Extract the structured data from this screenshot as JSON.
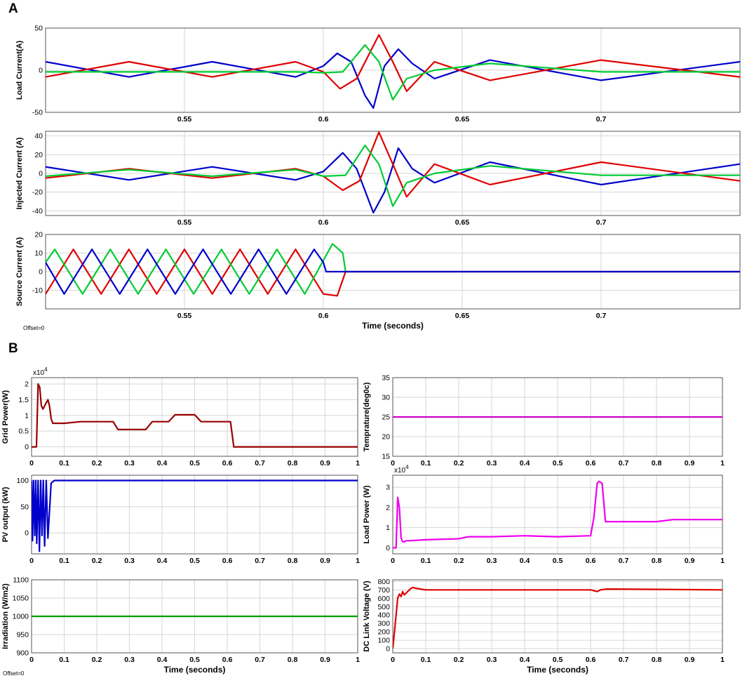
{
  "panel_labels": {
    "A": "A",
    "B": "B"
  },
  "offset_labels": {
    "A": "Offset=0",
    "B": "Offset=0"
  },
  "chart_data": [
    {
      "id": "load-current",
      "type": "line",
      "ylabel": "Load Current(A)",
      "xlim": [
        0.5,
        0.75
      ],
      "ylim": [
        -50,
        50
      ],
      "xticks": [
        0.55,
        0.6,
        0.65,
        0.7
      ],
      "xtick_labels": [
        "0.55",
        "0.6",
        "0.65",
        "0.7"
      ],
      "yticks": [
        -50,
        0,
        50
      ],
      "ytick_labels": [
        "-50",
        "0",
        "50"
      ],
      "series": [
        {
          "color": "#0000cc",
          "x": [
            0.5,
            0.53,
            0.56,
            0.59,
            0.6,
            0.605,
            0.61,
            0.615,
            0.618,
            0.622,
            0.627,
            0.632,
            0.64,
            0.66,
            0.7,
            0.75
          ],
          "y": [
            10,
            -8,
            10,
            -8,
            5,
            20,
            10,
            -30,
            -45,
            5,
            25,
            8,
            -10,
            12,
            -12,
            10
          ]
        },
        {
          "color": "#e00000",
          "x": [
            0.5,
            0.53,
            0.56,
            0.59,
            0.6,
            0.606,
            0.612,
            0.62,
            0.625,
            0.63,
            0.64,
            0.66,
            0.7,
            0.75
          ],
          "y": [
            -8,
            10,
            -8,
            10,
            -2,
            -22,
            -10,
            42,
            10,
            -25,
            10,
            -12,
            12,
            -8
          ]
        },
        {
          "color": "#00cc33",
          "x": [
            0.5,
            0.53,
            0.56,
            0.59,
            0.6,
            0.607,
            0.615,
            0.62,
            0.625,
            0.63,
            0.64,
            0.66,
            0.7,
            0.75
          ],
          "y": [
            -2,
            -2,
            -2,
            -2,
            -3,
            -2,
            30,
            10,
            -35,
            -10,
            0,
            8,
            -2,
            -2
          ]
        }
      ]
    },
    {
      "id": "injected-current",
      "type": "line",
      "ylabel": "Injected Current (A)",
      "xlim": [
        0.5,
        0.75
      ],
      "ylim": [
        -45,
        45
      ],
      "xticks": [
        0.55,
        0.6,
        0.65,
        0.7
      ],
      "xtick_labels": [
        "0.55",
        "0.6",
        "0.65",
        "0.7"
      ],
      "yticks": [
        -40,
        -20,
        0,
        20,
        40
      ],
      "ytick_labels": [
        "-40",
        "-20",
        "0",
        "20",
        "40"
      ],
      "series": [
        {
          "color": "#0000cc",
          "x": [
            0.5,
            0.53,
            0.56,
            0.59,
            0.6,
            0.607,
            0.612,
            0.618,
            0.622,
            0.627,
            0.632,
            0.64,
            0.66,
            0.7,
            0.75
          ],
          "y": [
            7,
            -7,
            7,
            -7,
            2,
            22,
            5,
            -42,
            -20,
            27,
            5,
            -10,
            12,
            -12,
            10
          ]
        },
        {
          "color": "#e00000",
          "x": [
            0.5,
            0.53,
            0.56,
            0.59,
            0.6,
            0.607,
            0.613,
            0.62,
            0.625,
            0.63,
            0.64,
            0.66,
            0.7,
            0.75
          ],
          "y": [
            -5,
            5,
            -5,
            5,
            -3,
            -18,
            -8,
            44,
            10,
            -25,
            10,
            -12,
            12,
            -8
          ]
        },
        {
          "color": "#00cc33",
          "x": [
            0.5,
            0.53,
            0.56,
            0.59,
            0.6,
            0.608,
            0.615,
            0.62,
            0.625,
            0.63,
            0.64,
            0.66,
            0.7,
            0.75
          ],
          "y": [
            -3,
            4,
            -3,
            4,
            -3,
            -2,
            30,
            10,
            -35,
            -10,
            0,
            8,
            -2,
            -2
          ]
        }
      ]
    },
    {
      "id": "source-current",
      "type": "line",
      "ylabel": "Source Current (A)",
      "xlabel": "Time (seconds)",
      "xlim": [
        0.5,
        0.75
      ],
      "ylim": [
        -20,
        20
      ],
      "xticks": [
        0.55,
        0.6,
        0.65,
        0.7
      ],
      "xtick_labels": [
        "0.55",
        "0.6",
        "0.65",
        "0.7"
      ],
      "yticks": [
        -10,
        0,
        10,
        20
      ],
      "ytick_labels": [
        "-10",
        "0",
        "10",
        "20"
      ],
      "series": [
        {
          "color": "#e00000",
          "x": [
            0.5,
            0.51,
            0.52,
            0.53,
            0.54,
            0.55,
            0.56,
            0.57,
            0.58,
            0.59,
            0.6,
            0.605,
            0.608,
            0.609,
            0.75
          ],
          "y": [
            -12,
            12,
            -12,
            12,
            -12,
            12,
            -12,
            12,
            -12,
            12,
            -12,
            -13,
            0,
            0,
            0
          ]
        },
        {
          "color": "#00cc33",
          "x": [
            0.5,
            0.5033,
            0.5133,
            0.5233,
            0.5333,
            0.5433,
            0.5533,
            0.5633,
            0.5733,
            0.5833,
            0.5933,
            0.6033,
            0.607,
            0.608,
            0.609
          ],
          "y": [
            5,
            12,
            -12,
            12,
            -12,
            12,
            -12,
            12,
            -12,
            12,
            -12,
            15,
            10,
            0,
            0
          ]
        },
        {
          "color": "#0000cc",
          "x": [
            0.5,
            0.5067,
            0.5167,
            0.5267,
            0.5367,
            0.5467,
            0.5567,
            0.5667,
            0.5767,
            0.5867,
            0.5967,
            0.6,
            0.601,
            0.75
          ],
          "y": [
            5,
            -12,
            12,
            -12,
            12,
            -12,
            12,
            -12,
            12,
            -12,
            12,
            5,
            0,
            0
          ]
        }
      ]
    },
    {
      "id": "grid-power",
      "type": "line",
      "ylabel": "Grid Power(W)",
      "exponent": "x10^4",
      "xlim": [
        0,
        1
      ],
      "ylim": [
        -0.3,
        2.2
      ],
      "xticks": [
        0,
        0.1,
        0.2,
        0.3,
        0.4,
        0.5,
        0.6,
        0.7,
        0.8,
        0.9,
        1
      ],
      "xtick_labels": [
        "0",
        "0.1",
        "0.2",
        "0.3",
        "0.4",
        "0.5",
        "0.6",
        "0.7",
        "0.8",
        "0.9",
        "1"
      ],
      "yticks": [
        0,
        0.5,
        1,
        1.5,
        2
      ],
      "ytick_labels": [
        "0",
        "0.5",
        "1",
        "1.5",
        "2"
      ],
      "series": [
        {
          "color": "#990000",
          "x": [
            0,
            0.015,
            0.02,
            0.025,
            0.03,
            0.035,
            0.04,
            0.045,
            0.05,
            0.055,
            0.06,
            0.065,
            0.1,
            0.15,
            0.25,
            0.265,
            0.35,
            0.37,
            0.42,
            0.44,
            0.5,
            0.52,
            0.6,
            0.61,
            0.62,
            1
          ],
          "y": [
            0,
            0,
            2.0,
            1.9,
            1.3,
            1.2,
            1.3,
            1.4,
            1.5,
            1.3,
            0.9,
            0.75,
            0.75,
            0.8,
            0.8,
            0.55,
            0.55,
            0.8,
            0.8,
            1.02,
            1.02,
            0.8,
            0.8,
            0.8,
            0,
            0
          ]
        }
      ]
    },
    {
      "id": "temperature",
      "type": "line",
      "ylabel": "Temprature(deg0c)",
      "xlim": [
        0,
        1
      ],
      "ylim": [
        15,
        35
      ],
      "xticks": [
        0,
        0.1,
        0.2,
        0.3,
        0.4,
        0.5,
        0.6,
        0.7,
        0.8,
        0.9,
        1
      ],
      "xtick_labels": [
        "0",
        "0.1",
        "0.2",
        "0.3",
        "0.4",
        "0.5",
        "0.6",
        "0.7",
        "0.8",
        "0.9",
        "1"
      ],
      "yticks": [
        15,
        20,
        25,
        30,
        35
      ],
      "ytick_labels": [
        "15",
        "20",
        "25",
        "30",
        "35"
      ],
      "series": [
        {
          "color": "#cc00cc",
          "x": [
            0,
            1
          ],
          "y": [
            25,
            25
          ]
        }
      ]
    },
    {
      "id": "pv-output",
      "type": "line",
      "ylabel": "PV output (kW)",
      "xlim": [
        0,
        1
      ],
      "ylim": [
        -40,
        110
      ],
      "xticks": [
        0,
        0.1,
        0.2,
        0.3,
        0.4,
        0.5,
        0.6,
        0.7,
        0.8,
        0.9,
        1
      ],
      "xtick_labels": [
        "0",
        "0.1",
        "0.2",
        "0.3",
        "0.4",
        "0.5",
        "0.6",
        "0.7",
        "0.8",
        "0.9",
        "1"
      ],
      "yticks": [
        0,
        50,
        100
      ],
      "ytick_labels": [
        "0",
        "50",
        "100"
      ],
      "series": [
        {
          "color": "#0000cc",
          "x": [
            0,
            0.003,
            0.006,
            0.01,
            0.013,
            0.016,
            0.02,
            0.024,
            0.028,
            0.032,
            0.036,
            0.04,
            0.045,
            0.05,
            0.06,
            0.07,
            0.1,
            1
          ],
          "y": [
            100,
            -15,
            100,
            -5,
            100,
            -20,
            100,
            -35,
            100,
            -5,
            100,
            -25,
            100,
            -10,
            95,
            100,
            100,
            100
          ]
        }
      ]
    },
    {
      "id": "load-power",
      "type": "line",
      "ylabel": "Load Power (W)",
      "exponent": "x10^4",
      "xlim": [
        0,
        1
      ],
      "ylim": [
        -0.3,
        3.6
      ],
      "xticks": [
        0,
        0.1,
        0.2,
        0.3,
        0.4,
        0.5,
        0.6,
        0.7,
        0.8,
        0.9,
        1
      ],
      "xtick_labels": [
        "0",
        "0.1",
        "0.2",
        "0.3",
        "0.4",
        "0.5",
        "0.6",
        "0.7",
        "0.8",
        "0.9",
        "1"
      ],
      "yticks": [
        0,
        1,
        2,
        3
      ],
      "ytick_labels": [
        "0",
        "1",
        "2",
        "3"
      ],
      "series": [
        {
          "color": "#ee00ee",
          "x": [
            0,
            0.01,
            0.015,
            0.02,
            0.025,
            0.03,
            0.035,
            0.04,
            0.05,
            0.1,
            0.2,
            0.23,
            0.3,
            0.4,
            0.5,
            0.6,
            0.61,
            0.62,
            0.625,
            0.635,
            0.645,
            0.7,
            0.8,
            0.85,
            1
          ],
          "y": [
            0,
            0,
            2.5,
            2.0,
            0.5,
            0.3,
            0.3,
            0.35,
            0.35,
            0.4,
            0.45,
            0.55,
            0.55,
            0.6,
            0.55,
            0.6,
            1.5,
            3.2,
            3.3,
            3.2,
            1.3,
            1.3,
            1.3,
            1.4,
            1.4
          ]
        }
      ]
    },
    {
      "id": "irradiation",
      "type": "line",
      "ylabel": "Irradiation (W/m2)",
      "xlabel": "Time (seconds)",
      "xlim": [
        0,
        1
      ],
      "ylim": [
        900,
        1100
      ],
      "xticks": [
        0,
        0.1,
        0.2,
        0.3,
        0.4,
        0.5,
        0.6,
        0.7,
        0.8,
        0.9,
        1
      ],
      "xtick_labels": [
        "0",
        "0.1",
        "0.2",
        "0.3",
        "0.4",
        "0.5",
        "0.6",
        "0.7",
        "0.8",
        "0.9",
        "1"
      ],
      "yticks": [
        900,
        950,
        1000,
        1050,
        1100
      ],
      "ytick_labels": [
        "900",
        "950",
        "1000",
        "1050",
        "1100"
      ],
      "series": [
        {
          "color": "#009900",
          "x": [
            0,
            1
          ],
          "y": [
            1000,
            1000
          ]
        }
      ]
    },
    {
      "id": "dc-link-voltage",
      "type": "line",
      "ylabel": "DC Link Voltage (V)",
      "xlabel": "Time (seconds)",
      "xlim": [
        0,
        1
      ],
      "ylim": [
        -50,
        820
      ],
      "xticks": [
        0,
        0.1,
        0.2,
        0.3,
        0.4,
        0.5,
        0.6,
        0.7,
        0.8,
        0.9,
        1
      ],
      "xtick_labels": [
        "0",
        "0.1",
        "0.2",
        "0.3",
        "0.4",
        "0.5",
        "0.6",
        "0.7",
        "0.8",
        "0.9",
        "1"
      ],
      "yticks": [
        0,
        100,
        200,
        300,
        400,
        500,
        600,
        700,
        800
      ],
      "ytick_labels": [
        "0",
        "100",
        "200",
        "300",
        "400",
        "500",
        "600",
        "700",
        "800"
      ],
      "series": [
        {
          "color": "#e00000",
          "x": [
            0,
            0.005,
            0.01,
            0.015,
            0.02,
            0.025,
            0.03,
            0.035,
            0.04,
            0.05,
            0.06,
            0.07,
            0.1,
            0.2,
            0.5,
            0.6,
            0.62,
            0.63,
            0.65,
            1
          ],
          "y": [
            0,
            200,
            400,
            600,
            650,
            620,
            680,
            640,
            660,
            700,
            730,
            720,
            700,
            700,
            700,
            700,
            680,
            700,
            710,
            700
          ]
        }
      ]
    }
  ]
}
